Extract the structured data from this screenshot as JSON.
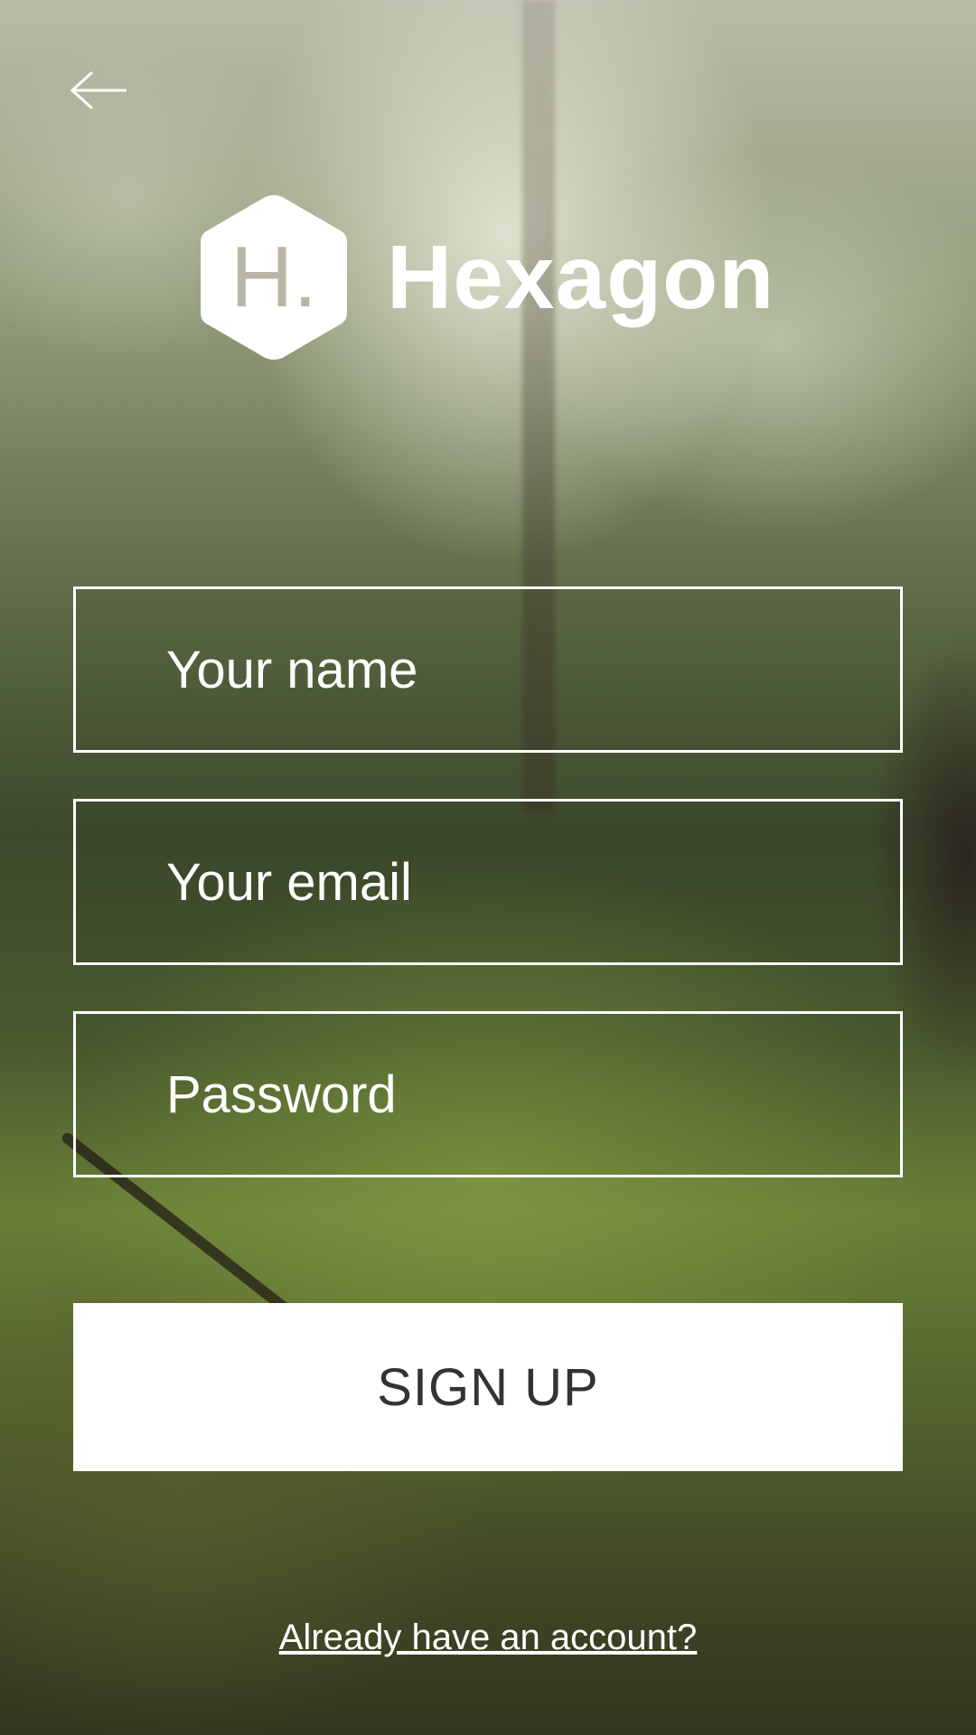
{
  "app": {
    "name": "Hexagon",
    "logo_letter": "H."
  },
  "nav": {
    "back_icon": "arrow-left-icon"
  },
  "form": {
    "name_placeholder": "Your name",
    "name_value": "",
    "email_placeholder": "Your email",
    "email_value": "",
    "password_placeholder": "Password",
    "password_value": ""
  },
  "actions": {
    "signup_label": "SIGN UP",
    "login_link": "Already have an account?"
  },
  "colors": {
    "text": "#ffffff",
    "button_bg": "#ffffff",
    "button_text": "#333333"
  }
}
